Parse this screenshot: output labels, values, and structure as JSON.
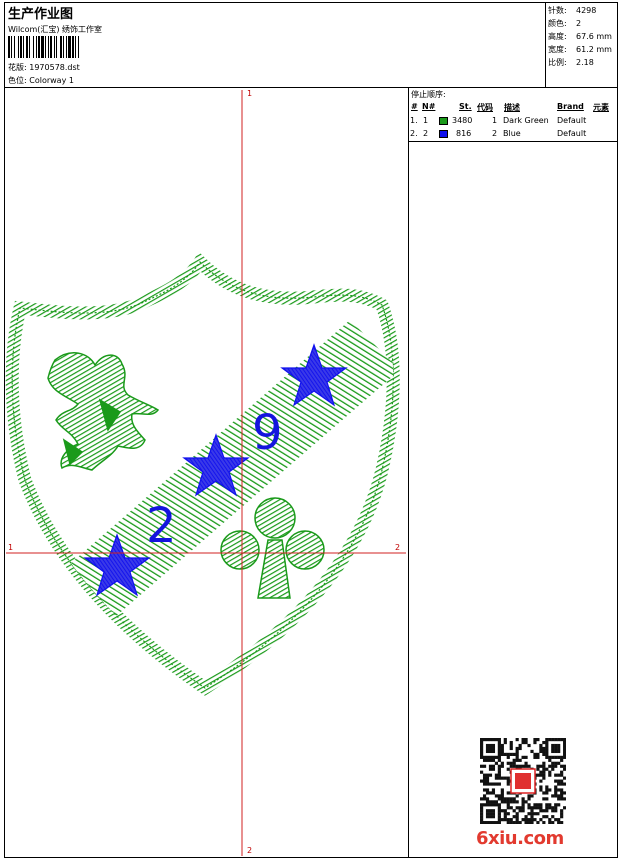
{
  "header": {
    "title": "生产作业图",
    "company": "Wilcom(汇宝) 绣饰工作室",
    "pattern_label": "花版: ",
    "pattern_value": "1970578.dst",
    "colorway_label": "色位: ",
    "colorway_value": "Colorway 1"
  },
  "stats": [
    {
      "label": "针数:",
      "value": "4298"
    },
    {
      "label": "颜色:",
      "value": "2"
    },
    {
      "label": "高度:",
      "value": "67.6 mm"
    },
    {
      "label": "宽度:",
      "value": "61.2 mm"
    },
    {
      "label": "比例:",
      "value": "2.18"
    }
  ],
  "stop_sequence": {
    "title": "停止顺序:",
    "headers": {
      "num": "#",
      "no": "N#",
      "st": "St.",
      "code": "代码",
      "desc": "描述",
      "brand": "Brand",
      "element": "元素"
    },
    "rows": [
      {
        "num": "1.",
        "no": "1",
        "color": "#1a9a1a",
        "st": "3480",
        "code": "1",
        "desc": "Dark Green",
        "brand": "Default"
      },
      {
        "num": "2.",
        "no": "2",
        "color": "#1010ee",
        "st": "816",
        "code": "2",
        "desc": "Blue",
        "brand": "Default"
      }
    ]
  },
  "canvas": {
    "axis_top": "1",
    "axis_left": "1",
    "axis_right": "2",
    "axis_bottom": "2",
    "design_text_left": "2",
    "design_text_right": "9"
  },
  "colors": {
    "green": "#1a9a1a",
    "blue": "#1010ee",
    "crosshair": "#d02020"
  },
  "watermark": {
    "text": "6xiu.com"
  }
}
